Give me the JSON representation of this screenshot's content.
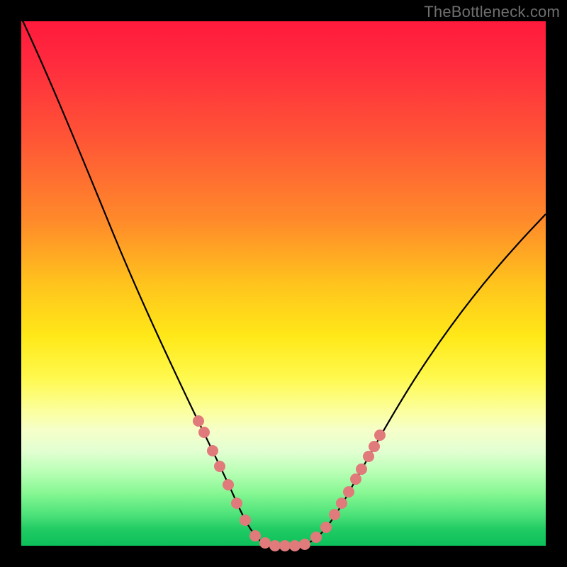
{
  "watermark": "TheBottleneck.com",
  "colors": {
    "frame": "#000000",
    "marker": "#e17a7a",
    "curve": "#000000",
    "gradient_top": "#ff1a3c",
    "gradient_bottom": "#0dc05a"
  },
  "chart_data": {
    "type": "line",
    "title": "",
    "xlabel": "",
    "ylabel": "",
    "xlim": [
      0,
      100
    ],
    "ylim": [
      0,
      100
    ],
    "x": [
      0,
      5,
      10,
      15,
      20,
      25,
      30,
      35,
      37,
      40,
      43,
      45,
      47,
      50,
      53,
      55,
      60,
      65,
      70,
      75,
      80,
      85,
      90,
      95,
      100
    ],
    "y": [
      100,
      90,
      79,
      67,
      56,
      44,
      33,
      20,
      15,
      8,
      3,
      1,
      0,
      0,
      0,
      1,
      6,
      15,
      24,
      32,
      40,
      47,
      54,
      60,
      65
    ],
    "note": "Values approximated from plot coordinates; y=0 at bottom (green), y=100 at top (red).",
    "markers": {
      "comment": "Pink dots overlaid on the curve (approx x positions).",
      "x": [
        33,
        34.5,
        36,
        37.5,
        39,
        41,
        43,
        45,
        47,
        49,
        51,
        53,
        55,
        56.5,
        58,
        59.5,
        61,
        63,
        65
      ]
    }
  }
}
